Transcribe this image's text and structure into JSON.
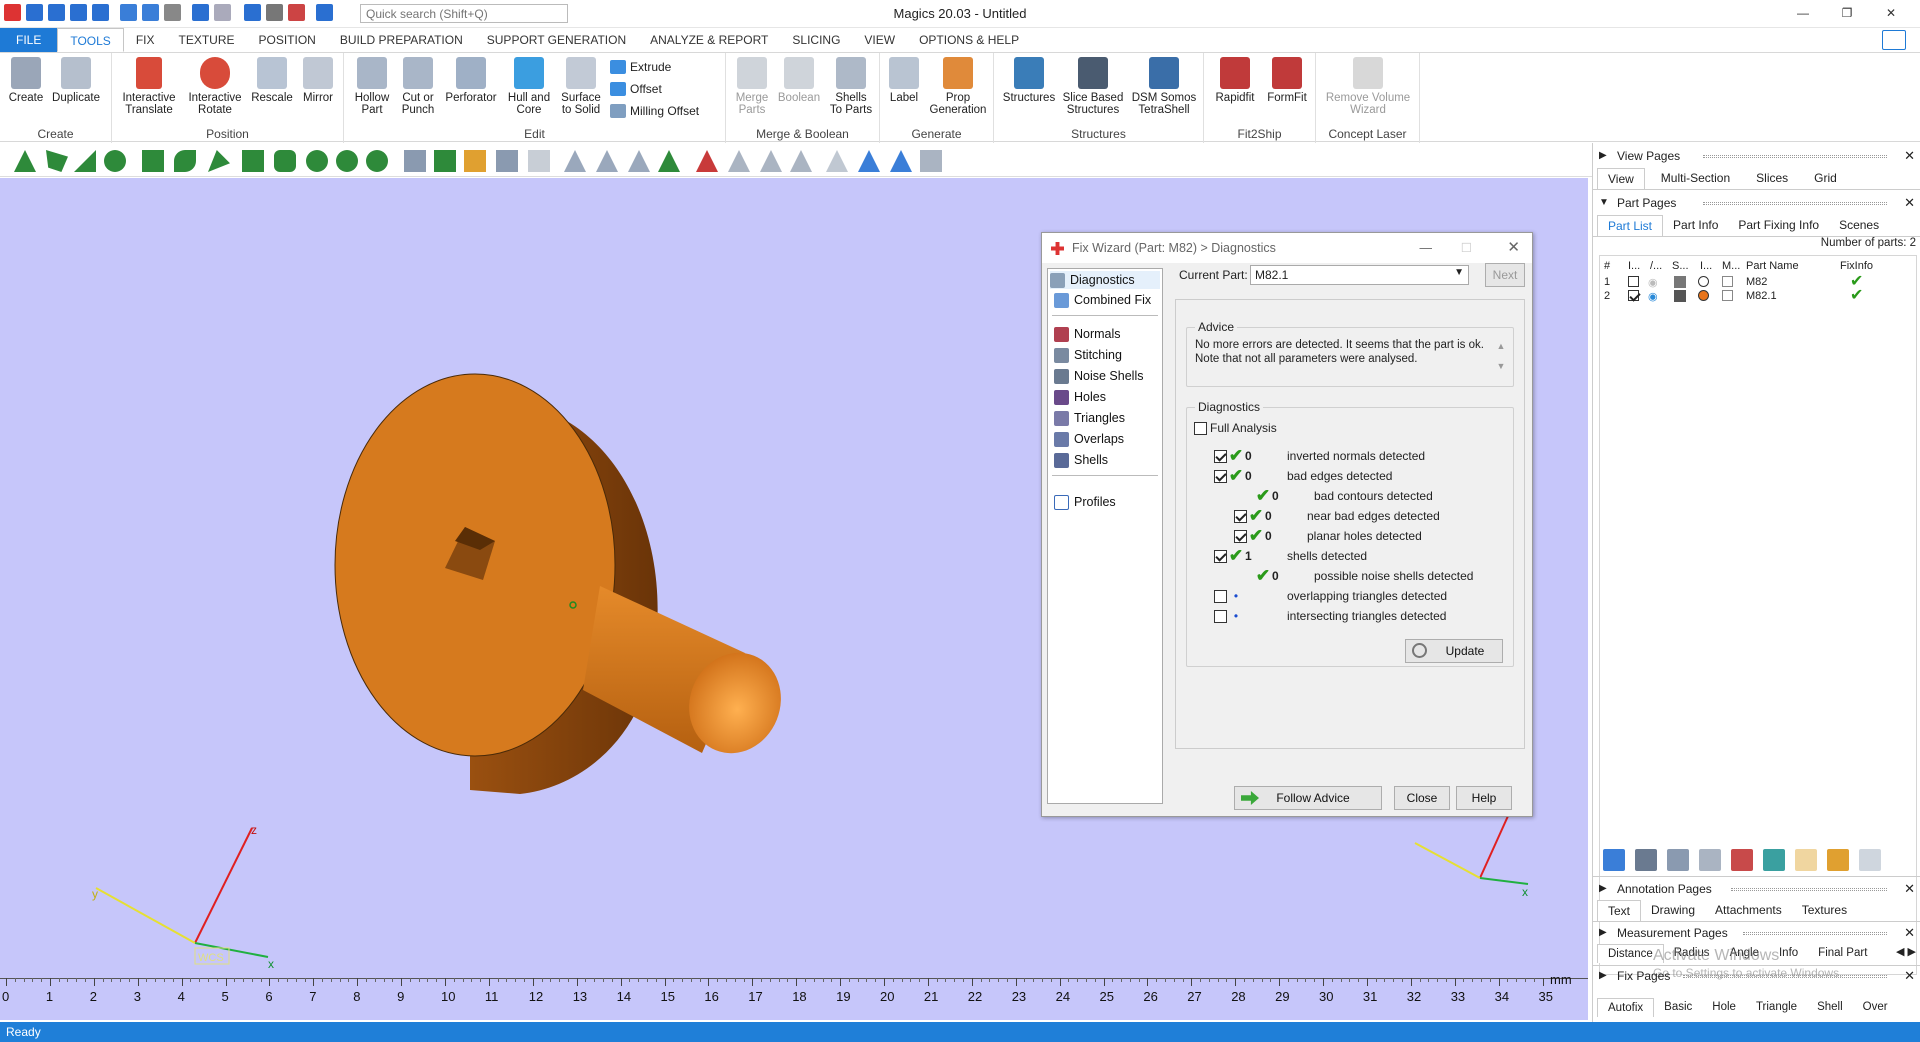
{
  "app": {
    "title": "Magics 20.03 - Untitled",
    "search_placeholder": "Quick search (Shift+Q)"
  },
  "window_controls": [
    "—",
    "❐",
    "✕"
  ],
  "menu": [
    "FILE",
    "TOOLS",
    "FIX",
    "TEXTURE",
    "POSITION",
    "BUILD PREPARATION",
    "SUPPORT GENERATION",
    "ANALYZE & REPORT",
    "SLICING",
    "VIEW",
    "OPTIONS & HELP"
  ],
  "menu_active": "TOOLS",
  "ribbon": {
    "create": {
      "label": "Create",
      "btn1": "Create",
      "btn2": "Duplicate"
    },
    "position": {
      "label": "Position",
      "btn1a": "Interactive",
      "btn1b": "Translate",
      "btn2a": "Interactive",
      "btn2b": "Rotate",
      "btn3": "Rescale",
      "btn4": "Mirror"
    },
    "edit": {
      "label": "Edit",
      "hollow_a": "Hollow",
      "hollow_b": "Part",
      "cut_a": "Cut or",
      "cut_b": "Punch",
      "perforator": "Perforator",
      "hull_a": "Hull and",
      "hull_b": "Core",
      "surface_a": "Surface",
      "surface_b": "to Solid",
      "extrude": "Extrude",
      "offset": "Offset",
      "milling": "Milling Offset"
    },
    "merge": {
      "label": "Merge & Boolean",
      "merge_a": "Merge",
      "merge_b": "Parts",
      "boolean": "Boolean",
      "shells_a": "Shells",
      "shells_b": "To Parts"
    },
    "generate": {
      "label": "Generate",
      "label_btn": "Label",
      "prop_a": "Prop",
      "prop_b": "Generation"
    },
    "structures": {
      "label": "Structures",
      "btn1": "Structures",
      "slice_a": "Slice Based",
      "slice_b": "Structures",
      "dsm_a": "DSM Somos",
      "dsm_b": "TetraShell"
    },
    "fit2ship": {
      "label": "Fit2Ship",
      "btn1": "Rapidfit",
      "btn2": "FormFit"
    },
    "concept": {
      "label": "Concept Laser",
      "btn_a": "Remove Volume",
      "btn_b": "Wizard"
    }
  },
  "colors": {
    "accent": "#1e7ad6",
    "viewport": "#c6c6fa",
    "part": "#d67a1e",
    "status": "#1f7fd8"
  },
  "viewport": {
    "axis_z": "z",
    "axis_x": "x",
    "axis_y": "y",
    "wcs": "WCS",
    "ruler_unit": "mm",
    "ruler_ticks": [
      "0",
      "1",
      "2",
      "3",
      "4",
      "5",
      "6",
      "7",
      "8",
      "9",
      "10",
      "11",
      "12",
      "13",
      "14",
      "15",
      "16",
      "17",
      "18",
      "19",
      "20",
      "21",
      "22",
      "23",
      "24",
      "25",
      "26",
      "27",
      "28",
      "29",
      "30",
      "31",
      "32",
      "33",
      "34",
      "35"
    ]
  },
  "dialog": {
    "title": "Fix Wizard (Part: M82) > Diagnostics",
    "nav": [
      "Diagnostics",
      "Combined Fix",
      "Normals",
      "Stitching",
      "Noise Shells",
      "Holes",
      "Triangles",
      "Overlaps",
      "Shells",
      "Profiles"
    ],
    "current_part_label": "Current Part:",
    "current_part_value": "M82.1",
    "next": "Next",
    "advice_legend": "Advice",
    "advice_text": "No more errors are detected. It seems that the part is ok. Note that not all parameters were analysed.",
    "diagnostics_legend": "Diagnostics",
    "full_analysis": "Full Analysis",
    "rows": [
      {
        "count": "0",
        "text": "inverted normals detected"
      },
      {
        "count": "0",
        "text": "bad edges detected"
      },
      {
        "count": "0",
        "text": "bad contours detected"
      },
      {
        "count": "0",
        "text": "near bad edges detected"
      },
      {
        "count": "0",
        "text": "planar holes detected"
      },
      {
        "count": "1",
        "text": "shells detected"
      },
      {
        "count": "0",
        "text": "possible noise shells detected"
      },
      {
        "count": "",
        "text": "overlapping triangles detected"
      },
      {
        "count": "",
        "text": "intersecting triangles detected"
      }
    ],
    "update": "Update",
    "follow_advice": "Follow Advice",
    "close": "Close",
    "help": "Help"
  },
  "right_panel": {
    "view_pages": "View Pages",
    "view_tabs": [
      "View",
      "Multi-Section",
      "Slices",
      "Grid"
    ],
    "part_pages": "Part Pages",
    "part_tabs": [
      "Part List",
      "Part Info",
      "Part Fixing Info",
      "Scenes"
    ],
    "num_parts": "Number of parts: 2",
    "columns": [
      "#",
      "I...",
      "/...",
      "S...",
      "I...",
      "M...",
      "Part Name",
      "FixInfo"
    ],
    "parts": [
      {
        "n": "1",
        "name": "M82"
      },
      {
        "n": "2",
        "name": "M82.1"
      }
    ],
    "annotation_pages": "Annotation Pages",
    "annotation_tabs": [
      "Text",
      "Drawing",
      "Attachments",
      "Textures"
    ],
    "measurement_pages": "Measurement Pages",
    "measurement_tabs": [
      "Distance",
      "Radius",
      "Angle",
      "Info",
      "Final Part"
    ],
    "fix_pages": "Fix Pages",
    "fix_tabs": [
      "Autofix",
      "Basic",
      "Hole",
      "Triangle",
      "Shell",
      "Over"
    ],
    "watermark1": "Activate Windows",
    "watermark2": "Go to Settings to activate Windows."
  },
  "status": "Ready"
}
